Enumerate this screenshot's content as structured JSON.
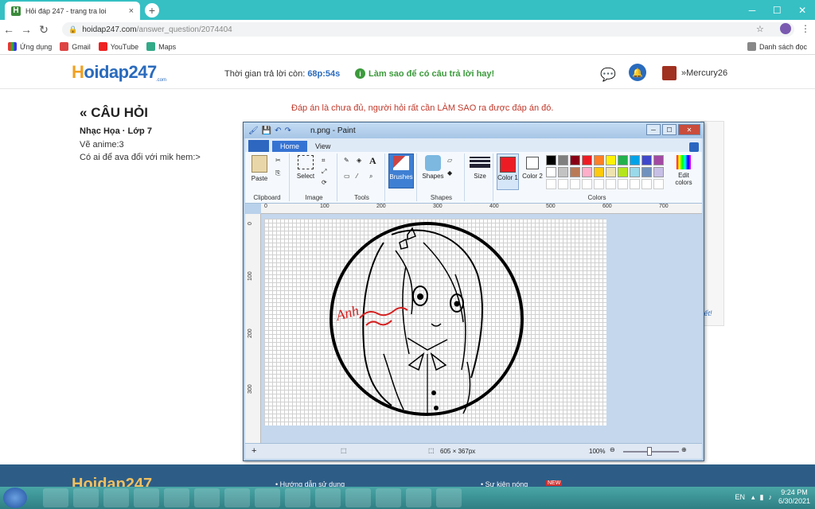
{
  "browser": {
    "tab_title": "Hỏi đáp 247 - trang tra loi",
    "tab_close": "×",
    "new_tab": "+",
    "url_host": "hoidap247.com",
    "url_path": "/answer_question/2074404",
    "bookmarks": [
      "Ứng dụng",
      "Gmail",
      "YouTube",
      "Maps"
    ],
    "reading_list": "Danh sách đọc"
  },
  "site": {
    "logo_main": "oidap247",
    "logo_h": "H",
    "logo_sub": ".com",
    "timer_label": "Thời gian trả lời còn:",
    "timer_value": "68p:54s",
    "hint": "Làm sao để có câu trả lời hay!",
    "username": "Mercury26"
  },
  "question": {
    "heading": "CÂU HỎI",
    "subject": "Nhạc Họa · Lớp 7",
    "line1": "Vẽ anime:3",
    "line2": "Có ai để ava đổi với mik hem:>"
  },
  "warning": "Đáp án là chưa đủ, người hỏi rất cần LÀM SAO ra được đáp án đó.",
  "side_link": "yết!",
  "footer": {
    "logo": "Hoidap247",
    "link1": "Hướng dẫn sử dụng",
    "link2": "Sự kiện nóng",
    "new_badge": "NEW"
  },
  "paint": {
    "title": "n.png - Paint",
    "tabs": [
      "Home",
      "View"
    ],
    "groups": {
      "clipboard": "Clipboard",
      "image": "Image",
      "tools": "Tools",
      "shapes": "Shapes",
      "colors": "Colors"
    },
    "buttons": {
      "paste": "Paste",
      "select": "Select",
      "brushes": "Brushes",
      "shapes": "Shapes",
      "size": "Size",
      "color1": "Color 1",
      "color2": "Color 2",
      "edit_colors": "Edit colors"
    },
    "ruler_top": [
      "0",
      "100",
      "200",
      "300",
      "400",
      "500",
      "600",
      "700"
    ],
    "ruler_left": [
      "0",
      "100",
      "200",
      "300"
    ],
    "status_size": "605 × 367px",
    "zoom": "100%",
    "palette_row1": [
      "#000000",
      "#7f7f7f",
      "#880015",
      "#ed1c24",
      "#ff7f27",
      "#fff200",
      "#22b14c",
      "#00a2e8",
      "#3f48cc",
      "#a349a4"
    ],
    "palette_row2": [
      "#ffffff",
      "#c3c3c3",
      "#b97a57",
      "#ffaec9",
      "#ffc90e",
      "#efe4b0",
      "#b5e61d",
      "#99d9ea",
      "#7092be",
      "#c8bfe7"
    ],
    "color1": "#ed1c24",
    "color2": "#ffffff",
    "signature": "Anh"
  },
  "taskbar": {
    "lang": "EN",
    "time": "9:24 PM",
    "date": "6/30/2021"
  }
}
